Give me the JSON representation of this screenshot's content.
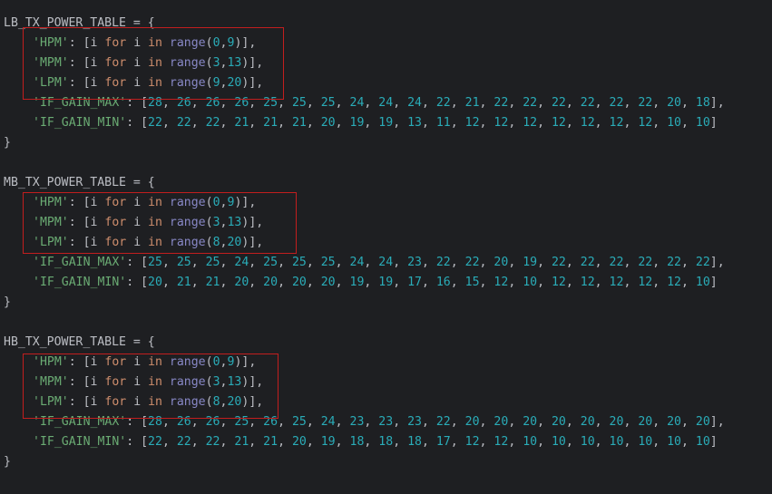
{
  "code": {
    "tables": [
      {
        "name": "LB_TX_POWER_TABLE",
        "rows": [
          {
            "key": "'HPM'",
            "args": [
              "0",
              "9"
            ]
          },
          {
            "key": "'MPM'",
            "args": [
              "3",
              "13"
            ]
          },
          {
            "key": "'LPM'",
            "args": [
              "9",
              "20"
            ]
          }
        ],
        "max": [
          "28",
          "26",
          "26",
          "26",
          "25",
          "25",
          "25",
          "24",
          "24",
          "24",
          "22",
          "21",
          "22",
          "22",
          "22",
          "22",
          "22",
          "22",
          "20",
          "18"
        ],
        "min": [
          "22",
          "22",
          "22",
          "21",
          "21",
          "21",
          "20",
          "19",
          "19",
          "13",
          "11",
          "12",
          "12",
          "12",
          "12",
          "12",
          "12",
          "12",
          "10",
          "10"
        ]
      },
      {
        "name": "MB_TX_POWER_TABLE",
        "rows": [
          {
            "key": "'HPM'",
            "args": [
              "0",
              "9"
            ]
          },
          {
            "key": "'MPM'",
            "args": [
              "3",
              "13"
            ]
          },
          {
            "key": "'LPM'",
            "args": [
              "8",
              "20"
            ]
          }
        ],
        "max": [
          "25",
          "25",
          "25",
          "24",
          "25",
          "25",
          "25",
          "24",
          "24",
          "23",
          "22",
          "22",
          "20",
          "19",
          "22",
          "22",
          "22",
          "22",
          "22",
          "22"
        ],
        "min": [
          "20",
          "21",
          "21",
          "20",
          "20",
          "20",
          "20",
          "19",
          "19",
          "17",
          "16",
          "15",
          "12",
          "10",
          "12",
          "12",
          "12",
          "12",
          "12",
          "10"
        ]
      },
      {
        "name": "HB_TX_POWER_TABLE",
        "rows": [
          {
            "key": "'HPM'",
            "args": [
              "0",
              "9"
            ]
          },
          {
            "key": "'MPM'",
            "args": [
              "3",
              "13"
            ]
          },
          {
            "key": "'LPM'",
            "args": [
              "8",
              "20"
            ]
          }
        ],
        "max": [
          "28",
          "26",
          "26",
          "25",
          "26",
          "25",
          "24",
          "23",
          "23",
          "23",
          "22",
          "20",
          "20",
          "20",
          "20",
          "20",
          "20",
          "20",
          "20",
          "20"
        ],
        "min": [
          "22",
          "22",
          "22",
          "21",
          "21",
          "20",
          "19",
          "18",
          "18",
          "18",
          "17",
          "12",
          "12",
          "10",
          "10",
          "10",
          "10",
          "10",
          "10",
          "10"
        ]
      }
    ],
    "assign": " = {",
    "close_brace": "}",
    "list_open": ": [",
    "list_close": "]",
    "comprehension": {
      "var": "i",
      "kw_for": "for",
      "kw_in": "in",
      "fn": "range"
    },
    "max_key": "'IF_GAIN_MAX'",
    "min_key": "'IF_GAIN_MIN'"
  },
  "colors": {
    "background": "#1e1f22",
    "string": "#6aab73",
    "keyword": "#cf8e6d",
    "builtin": "#8888c6",
    "number": "#2aacb8",
    "text": "#bcbec4",
    "highlight_box": "#c21e1e"
  }
}
